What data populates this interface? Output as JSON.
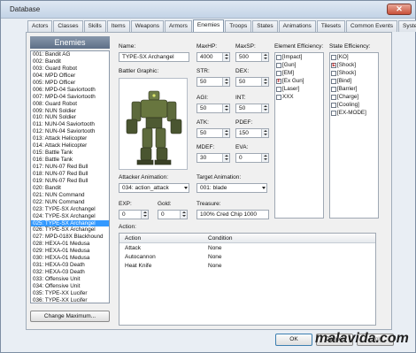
{
  "window": {
    "title": "Database",
    "close_glyph": "✕"
  },
  "tabs": [
    "Actors",
    "Classes",
    "Skills",
    "Items",
    "Weapons",
    "Armors",
    "Enemies",
    "Troops",
    "States",
    "Animations",
    "Tilesets",
    "Common Events",
    "System"
  ],
  "active_tab": "Enemies",
  "enemies_header": "Enemies",
  "enemies": [
    "001: Bandit AG",
    "002: Bandit",
    "003: Guard Robot",
    "004: MPD Officer",
    "005: MPD Officer",
    "006: MPD-04 Saviortooth",
    "007: MPD-04 Saviortooth",
    "008: Guard Robot",
    "009: NUN Soldier",
    "010: NUN Soldier",
    "011: NUN-04 Saviortooth",
    "012: NUN-04 Saviortooth",
    "013: Attack Helicopter",
    "014: Attack Helicopter",
    "015: Battle Tank",
    "016: Battle Tank",
    "017: NUN-07 Red Bull",
    "018: NUN-07 Red Bull",
    "019: NUN-07 Red Bull",
    "020: Bandit",
    "021: NUN Command",
    "022: NUN Command",
    "023: TYPE-SX Archangel",
    "024: TYPE-SX Archangel",
    "025: TYPE-SX Archangel",
    "026: TYPE-SX Archangel",
    "027: MPD-018X Blackhound",
    "028: HEXA-01 Medusa",
    "029: HEXA-01 Medusa",
    "030: HEXA-01 Medusa",
    "031: HEXA-03 Death",
    "032: HEXA-03 Death",
    "033: Offensive Unit",
    "034: Offensive Unit",
    "035: TYPE-XX Lucifer",
    "036: TYPE-XX Lucifer"
  ],
  "selected_index": 24,
  "change_max_label": "Change Maximum...",
  "labels": {
    "name": "Name:",
    "graphic": "Battler Graphic:",
    "maxhp": "MaxHP:",
    "maxsp": "MaxSP:",
    "str": "STR:",
    "dex": "DEX:",
    "agi": "AGI:",
    "int": "INT:",
    "atk": "ATK:",
    "pdef": "PDEF:",
    "mdef": "MDEF:",
    "eva": "EVA:",
    "attacker_anim": "Attacker Animation:",
    "target_anim": "Target Animation:",
    "exp": "EXP:",
    "gold": "Gold:",
    "treasure": "Treasure:",
    "action": "Action:",
    "element_eff": "Element Efficiency:",
    "state_eff": "State Efficiency:"
  },
  "values": {
    "name": "TYPE-SX Archangel",
    "maxhp": "4000",
    "maxsp": "500",
    "str": "50",
    "dex": "50",
    "agi": "50",
    "int": "50",
    "atk": "50",
    "pdef": "150",
    "mdef": "30",
    "eva": "0",
    "attacker_anim": "034: action_attack",
    "target_anim": "001: blade",
    "exp": "0",
    "gold": "0",
    "treasure": "100% Cred Chip 1000"
  },
  "elements": [
    {
      "label": "[Impact]",
      "mark": ""
    },
    {
      "label": "[Gun]",
      "mark": ""
    },
    {
      "label": "[EM]",
      "mark": ""
    },
    {
      "label": "[Ex Gun]",
      "mark": "F"
    },
    {
      "label": "[Laser]",
      "mark": ""
    },
    {
      "label": "XXX",
      "mark": ""
    }
  ],
  "states": [
    {
      "label": "[KO]",
      "mark": ""
    },
    {
      "label": "[Shock]",
      "mark": "E"
    },
    {
      "label": "[Shock]",
      "mark": ""
    },
    {
      "label": "[Bind]",
      "mark": ""
    },
    {
      "label": "[Barrier]",
      "mark": ""
    },
    {
      "label": "[Charge]",
      "mark": ""
    },
    {
      "label": "[Cooling]",
      "mark": ""
    },
    {
      "label": "[EX-MODE]",
      "mark": ""
    }
  ],
  "actions": {
    "headers": [
      "Action",
      "Condition"
    ],
    "rows": [
      [
        "Attack",
        "None"
      ],
      [
        "Autocannon",
        "None"
      ],
      [
        "Heat Knife",
        "None"
      ]
    ]
  },
  "buttons": {
    "ok": "OK",
    "cancel": "Cancel",
    "apply": "Apply"
  },
  "watermark": "malavida.com"
}
